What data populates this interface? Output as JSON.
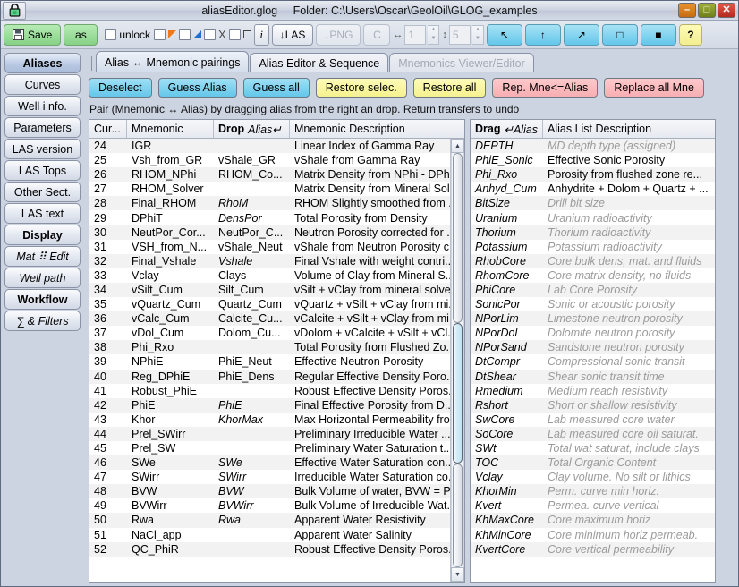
{
  "window": {
    "title": "aliasEditor.glog",
    "folder": "Folder: C:\\Users\\Oscar\\GeolOil\\GLOG_examples",
    "lock_icon": "lock-icon",
    "minimize_label": "–",
    "maximize_label": "□",
    "close_label": "✕",
    "accent_blue": "#63c7ea",
    "accent_green": "#86d186",
    "accent_yellow": "#f6f18e",
    "accent_pink": "#f8aeb2"
  },
  "toolbar": {
    "save_label": "Save",
    "save_icon": "floppy-disk-icon",
    "as_label": "as",
    "unlock_label": "unlock",
    "x_label": "X",
    "info_label": "i",
    "las_label": "↓LAS",
    "png_label": "↓PNG",
    "c_label": "C",
    "width_glyph": "↔",
    "width_value": "1",
    "height_glyph": "↕",
    "height_value": "5",
    "arrow_nw_label": "↖",
    "arrow_up_label": "↑",
    "arrow_ne_label": "↗",
    "square_outline_label": "□",
    "square_filled_label": "■",
    "help_label": "?"
  },
  "sidebar": {
    "items": [
      {
        "label": "Aliases",
        "state": "active"
      },
      {
        "label": "Curves",
        "state": "normal"
      },
      {
        "label": "Well i nfo.",
        "state": "normal"
      },
      {
        "label": "Parameters",
        "state": "normal"
      },
      {
        "label": "LAS version",
        "state": "normal"
      },
      {
        "label": "LAS Tops",
        "state": "normal"
      },
      {
        "label": "Other Sect.",
        "state": "normal"
      },
      {
        "label": "LAS text",
        "state": "normal"
      },
      {
        "label": "Display",
        "state": "bold"
      },
      {
        "label": "Mat ⠿ Edit",
        "state": "italic"
      },
      {
        "label": "Well path",
        "state": "italic"
      },
      {
        "label": "Workflow",
        "state": "bold"
      },
      {
        "label": "∑ & Filters",
        "state": "italic"
      }
    ]
  },
  "tabs": [
    {
      "label": "Alias ↔ Mnemonic pairings",
      "state": "active"
    },
    {
      "label": "Alias Editor & Sequence",
      "state": "normal"
    },
    {
      "label": "Mnemonics Viewer/Editor",
      "state": "disabled"
    }
  ],
  "actions": [
    {
      "label": "Deselect",
      "color": "blue"
    },
    {
      "label": "Guess Alias",
      "color": "blue"
    },
    {
      "label": "Guess all",
      "color": "blue"
    },
    {
      "label": "Restore selec.",
      "color": "yellow"
    },
    {
      "label": "Restore all",
      "color": "yellow"
    },
    {
      "label": "Rep. Mne<=Alias",
      "color": "pink"
    },
    {
      "label": "Replace all Mne",
      "color": "pink"
    }
  ],
  "hint": "Pair (Mnemonic ↔ Alias) by dragging alias from the right an drop. Return transfers to undo",
  "left_table": {
    "headers": {
      "cur": "Cur...",
      "mnemonic": "Mnemonic",
      "drop_bold": "Drop",
      "drop_italic": "Alias↵",
      "description": "Mnemonic Description"
    },
    "rows": [
      {
        "cur": "24",
        "mnemonic": "IGR",
        "alias": "",
        "alias_italic": false,
        "desc": "Linear Index of Gamma Ray"
      },
      {
        "cur": "25",
        "mnemonic": "Vsh_from_GR",
        "alias": "vShale_GR",
        "alias_italic": false,
        "desc": "vShale from Gamma Ray"
      },
      {
        "cur": "26",
        "mnemonic": "RHOM_NPhi",
        "alias": "RHOM_Co...",
        "alias_italic": false,
        "desc": "Matrix Density from NPhi - DPh..."
      },
      {
        "cur": "27",
        "mnemonic": "RHOM_Solver",
        "alias": "",
        "alias_italic": false,
        "desc": "Matrix Density from Mineral Sol..."
      },
      {
        "cur": "28",
        "mnemonic": "Final_RHOM",
        "alias": "RhoM",
        "alias_italic": true,
        "desc": "RHOM Slightly smoothed from ..."
      },
      {
        "cur": "29",
        "mnemonic": "DPhiT",
        "alias": "DensPor",
        "alias_italic": true,
        "desc": "Total Porosity from Density"
      },
      {
        "cur": "30",
        "mnemonic": "NeutPor_Cor...",
        "alias": "NeutPor_C...",
        "alias_italic": false,
        "desc": "Neutron Porosity corrected for ..."
      },
      {
        "cur": "31",
        "mnemonic": "VSH_from_N...",
        "alias": "vShale_Neut",
        "alias_italic": false,
        "desc": "vShale from Neutron Porosity c..."
      },
      {
        "cur": "32",
        "mnemonic": "Final_Vshale",
        "alias": "Vshale",
        "alias_italic": true,
        "desc": "Final Vshale with weight contri..."
      },
      {
        "cur": "33",
        "mnemonic": "Vclay",
        "alias": "Clays",
        "alias_italic": false,
        "desc": "Volume of Clay from Mineral S..."
      },
      {
        "cur": "34",
        "mnemonic": "vSilt_Cum",
        "alias": "Silt_Cum",
        "alias_italic": false,
        "desc": "vSilt + vClay from mineral solver"
      },
      {
        "cur": "35",
        "mnemonic": "vQuartz_Cum",
        "alias": "Quartz_Cum",
        "alias_italic": false,
        "desc": "vQuartz + vSilt + vClay from mi..."
      },
      {
        "cur": "36",
        "mnemonic": "vCalc_Cum",
        "alias": "Calcite_Cu...",
        "alias_italic": false,
        "desc": "vCalcite + vSilt + vClay from mi..."
      },
      {
        "cur": "37",
        "mnemonic": "vDol_Cum",
        "alias": "Dolom_Cu...",
        "alias_italic": false,
        "desc": "vDolom + vCalcite + vSilt + vCl..."
      },
      {
        "cur": "38",
        "mnemonic": "Phi_Rxo",
        "alias": "",
        "alias_italic": false,
        "desc": "Total Porosity from Flushed Zo..."
      },
      {
        "cur": "39",
        "mnemonic": "NPhiE",
        "alias": "PhiE_Neut",
        "alias_italic": false,
        "desc": "Effective Neutron Porosity"
      },
      {
        "cur": "40",
        "mnemonic": "Reg_DPhiE",
        "alias": "PhiE_Dens",
        "alias_italic": false,
        "desc": "Regular Effective Density Poro..."
      },
      {
        "cur": "41",
        "mnemonic": "Robust_PhiE",
        "alias": "",
        "alias_italic": false,
        "desc": "Robust Effective Density Poros..."
      },
      {
        "cur": "42",
        "mnemonic": "PhiE",
        "alias": "PhiE",
        "alias_italic": true,
        "desc": "Final Effective Porosity from D..."
      },
      {
        "cur": "43",
        "mnemonic": "Khor",
        "alias": "KhorMax",
        "alias_italic": true,
        "desc": "Max Horizontal Permeability fro..."
      },
      {
        "cur": "44",
        "mnemonic": "Prel_SWirr",
        "alias": "",
        "alias_italic": false,
        "desc": "Preliminary Irreducible Water ..."
      },
      {
        "cur": "45",
        "mnemonic": "Prel_SW",
        "alias": "",
        "alias_italic": false,
        "desc": "Preliminary Water Saturation t..."
      },
      {
        "cur": "46",
        "mnemonic": "SWe",
        "alias": "SWe",
        "alias_italic": true,
        "desc": "Effective Water Saturation con..."
      },
      {
        "cur": "47",
        "mnemonic": "SWirr",
        "alias": "SWirr",
        "alias_italic": true,
        "desc": "Irreducible Water Saturation co..."
      },
      {
        "cur": "48",
        "mnemonic": "BVW",
        "alias": "BVW",
        "alias_italic": true,
        "desc": "Bulk Volume of water, BVW = P..."
      },
      {
        "cur": "49",
        "mnemonic": "BVWirr",
        "alias": "BVWirr",
        "alias_italic": true,
        "desc": "Bulk Volume of Irreducible Wat..."
      },
      {
        "cur": "50",
        "mnemonic": "Rwa",
        "alias": "Rwa",
        "alias_italic": true,
        "desc": "Apparent Water Resistivity"
      },
      {
        "cur": "51",
        "mnemonic": "NaCl_app",
        "alias": "",
        "alias_italic": false,
        "desc": "Apparent Water Salinity"
      },
      {
        "cur": "52",
        "mnemonic": "QC_PhiR",
        "alias": "",
        "alias_italic": false,
        "desc": "Robust Effective Density Poros..."
      }
    ]
  },
  "right_table": {
    "headers": {
      "drag_bold": "Drag",
      "drag_italic": "↵Alias",
      "description": "Alias List Description"
    },
    "rows": [
      {
        "alias": "DEPTH",
        "desc": "MD depth type (assigned)",
        "dim": true
      },
      {
        "alias": "PhiE_Sonic",
        "desc": "Effective Sonic Porosity",
        "dim": false
      },
      {
        "alias": "Phi_Rxo",
        "desc": "Porosity from flushed zone re...",
        "dim": false
      },
      {
        "alias": "Anhyd_Cum",
        "desc": "Anhydrite + Dolom + Quartz + ...",
        "dim": false
      },
      {
        "alias": "BitSize",
        "desc": "Drill bit size",
        "dim": true
      },
      {
        "alias": "Uranium",
        "desc": "Uranium radioactivity",
        "dim": true
      },
      {
        "alias": "Thorium",
        "desc": "Thorium radioactivity",
        "dim": true
      },
      {
        "alias": "Potassium",
        "desc": "Potassium radioactivity",
        "dim": true
      },
      {
        "alias": "RhobCore",
        "desc": "Core bulk dens, mat. and fluids",
        "dim": true
      },
      {
        "alias": "RhomCore",
        "desc": "Core matrix density, no fluids",
        "dim": true
      },
      {
        "alias": "PhiCore",
        "desc": "Lab Core Porosity",
        "dim": true
      },
      {
        "alias": "SonicPor",
        "desc": "Sonic or acoustic porosity",
        "dim": true
      },
      {
        "alias": "NPorLim",
        "desc": "Limestone neutron porosity",
        "dim": true
      },
      {
        "alias": "NPorDol",
        "desc": "Dolomite neutron porosity",
        "dim": true
      },
      {
        "alias": "NPorSand",
        "desc": "Sandstone neutron porosity",
        "dim": true
      },
      {
        "alias": "DtCompr",
        "desc": "Compressional sonic transit",
        "dim": true
      },
      {
        "alias": "DtShear",
        "desc": "Shear sonic transit time",
        "dim": true
      },
      {
        "alias": "Rmedium",
        "desc": "Medium reach resistivity",
        "dim": true
      },
      {
        "alias": "Rshort",
        "desc": "Short or shallow resistivity",
        "dim": true
      },
      {
        "alias": "SwCore",
        "desc": "Lab measured core water",
        "dim": true
      },
      {
        "alias": "SoCore",
        "desc": "Lab measured core oil saturat.",
        "dim": true
      },
      {
        "alias": "SWt",
        "desc": "Total wat saturat, include clays",
        "dim": true
      },
      {
        "alias": "TOC",
        "desc": "Total Organic Content",
        "dim": true
      },
      {
        "alias": "Vclay",
        "desc": "Clay volume. No silt or lithics",
        "dim": true
      },
      {
        "alias": "KhorMin",
        "desc": "Perm. curve min horiz.",
        "dim": true
      },
      {
        "alias": "Kvert",
        "desc": "Permea. curve vertical",
        "dim": true
      },
      {
        "alias": "KhMaxCore",
        "desc": "Core maximum horiz",
        "dim": true
      },
      {
        "alias": "KhMinCore",
        "desc": "Core minimum horiz permeab.",
        "dim": true
      },
      {
        "alias": "KvertCore",
        "desc": "Core vertical permeability",
        "dim": true
      }
    ]
  },
  "scrollbar": {
    "up_arrow": "▲",
    "down_arrow": "▼"
  }
}
